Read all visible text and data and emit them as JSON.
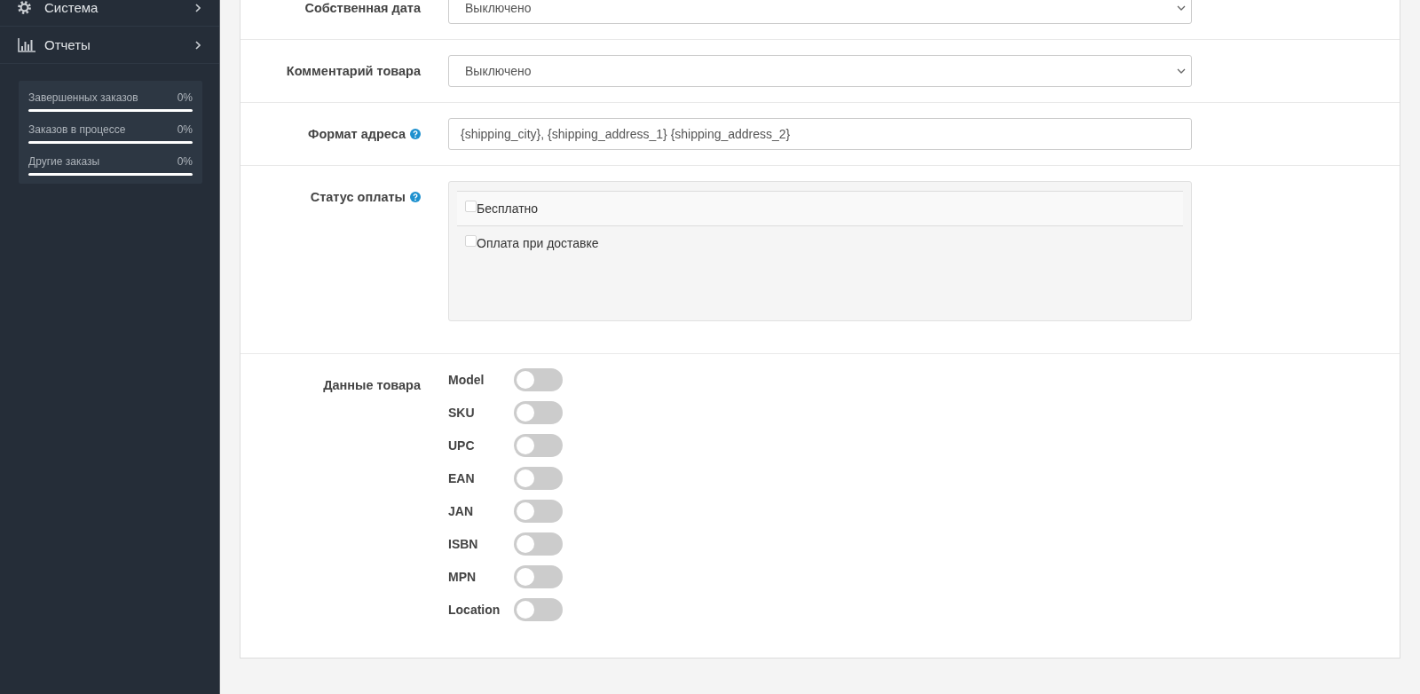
{
  "sidebar": {
    "menu": [
      {
        "label": "Система"
      },
      {
        "label": "Отчеты"
      }
    ],
    "stats": [
      {
        "label": "Завершенных заказов",
        "value": "0%"
      },
      {
        "label": "Заказов в процессе",
        "value": "0%"
      },
      {
        "label": "Другие заказы",
        "value": "0%"
      }
    ]
  },
  "form": {
    "fields": [
      {
        "kind": "select",
        "label": "Собственная дата",
        "help": false,
        "value": "Выключено"
      },
      {
        "kind": "select",
        "label": "Комментарий товара",
        "help": false,
        "value": "Выключено"
      },
      {
        "kind": "text",
        "label": "Формат адреса",
        "help": true,
        "value": "{shipping_city}, {shipping_address_1} {shipping_address_2}"
      },
      {
        "kind": "checklist",
        "label": "Статус оплаты",
        "help": true,
        "options": [
          {
            "label": "Бесплатно",
            "checked": false
          },
          {
            "label": "Оплата при доставке",
            "checked": false
          }
        ]
      },
      {
        "kind": "switches",
        "label": "Данные товара",
        "help": false,
        "toggles": [
          {
            "label": "Model",
            "on": false
          },
          {
            "label": "SKU",
            "on": false
          },
          {
            "label": "UPC",
            "on": false
          },
          {
            "label": "EAN",
            "on": false
          },
          {
            "label": "JAN",
            "on": false
          },
          {
            "label": "ISBN",
            "on": false
          },
          {
            "label": "MPN",
            "on": false
          },
          {
            "label": "Location",
            "on": false
          }
        ]
      }
    ]
  }
}
